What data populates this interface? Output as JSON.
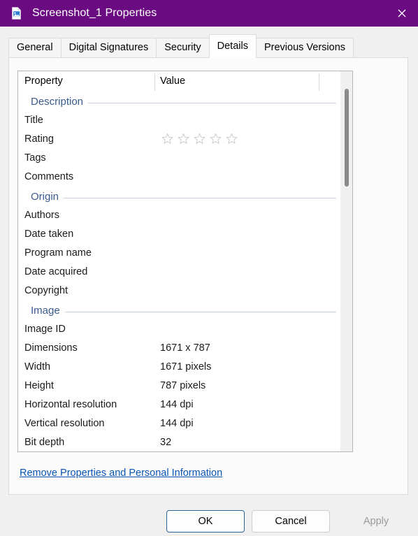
{
  "window": {
    "title": "Screenshot_1 Properties",
    "icon": "image-file-icon",
    "close_label": "✕",
    "titlebar_color": "#6b0b82"
  },
  "tabs": [
    {
      "label": "General",
      "active": false
    },
    {
      "label": "Digital Signatures",
      "active": false
    },
    {
      "label": "Security",
      "active": false
    },
    {
      "label": "Details",
      "active": true
    },
    {
      "label": "Previous Versions",
      "active": false
    }
  ],
  "list": {
    "columns": {
      "property": "Property",
      "value": "Value"
    },
    "sections": [
      {
        "title": "Description",
        "rows": [
          {
            "property": "Title",
            "value": ""
          },
          {
            "property": "Rating",
            "value": "",
            "rating": 0,
            "rating_max": 5
          },
          {
            "property": "Tags",
            "value": ""
          },
          {
            "property": "Comments",
            "value": ""
          }
        ]
      },
      {
        "title": "Origin",
        "rows": [
          {
            "property": "Authors",
            "value": ""
          },
          {
            "property": "Date taken",
            "value": ""
          },
          {
            "property": "Program name",
            "value": ""
          },
          {
            "property": "Date acquired",
            "value": ""
          },
          {
            "property": "Copyright",
            "value": ""
          }
        ]
      },
      {
        "title": "Image",
        "rows": [
          {
            "property": "Image ID",
            "value": ""
          },
          {
            "property": "Dimensions",
            "value": "1671 x 787"
          },
          {
            "property": "Width",
            "value": "1671 pixels"
          },
          {
            "property": "Height",
            "value": "787 pixels"
          },
          {
            "property": "Horizontal resolution",
            "value": "144 dpi"
          },
          {
            "property": "Vertical resolution",
            "value": "144 dpi"
          },
          {
            "property": "Bit depth",
            "value": "32"
          }
        ]
      }
    ]
  },
  "remove_link": {
    "label": "Remove Properties and Personal Information"
  },
  "buttons": {
    "ok": "OK",
    "cancel": "Cancel",
    "apply": "Apply"
  }
}
